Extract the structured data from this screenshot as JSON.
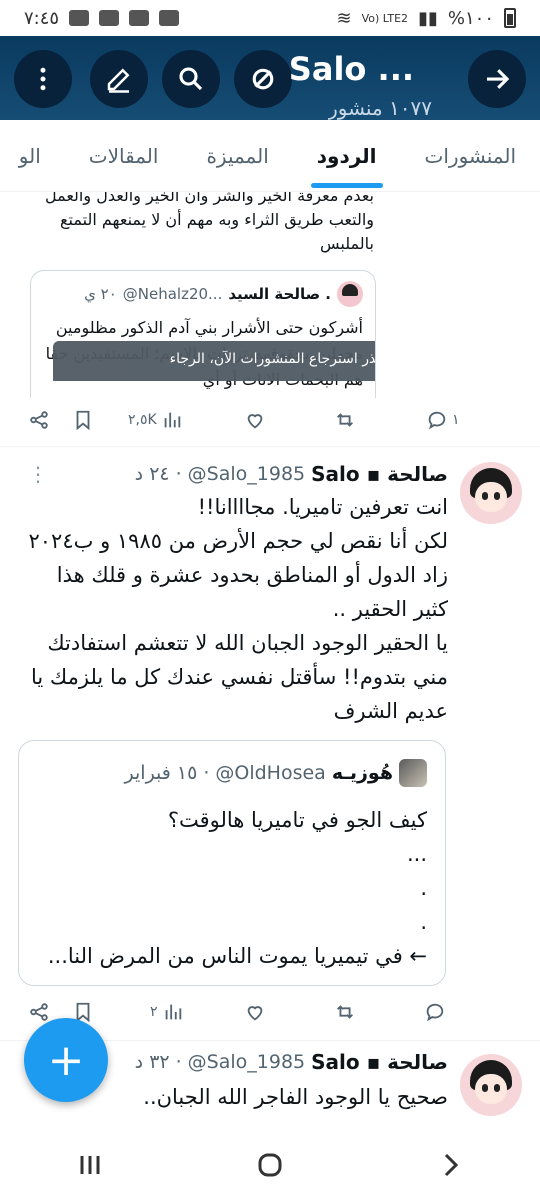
{
  "status_bar": {
    "time": "٧:٤٥",
    "battery": "%١٠٠",
    "network": "Vo) LTE2"
  },
  "header": {
    "title": "Salo ...",
    "subtitle": "١٠٧٧ منشور"
  },
  "tabs": [
    {
      "label": "المنشورات",
      "active": false
    },
    {
      "label": "الردود",
      "active": true
    },
    {
      "label": "المميزة",
      "active": false
    },
    {
      "label": "المقالات",
      "active": false
    },
    {
      "label": "الو",
      "active": false
    }
  ],
  "top_post": {
    "text": "بعدم معرفة الخير والشر وأن الخير والعدل والعمل والتعب طريق الثراء وبه مهم أن لا يمنعهم التمتع بالملبس",
    "quote": {
      "name": "صالحة السيد .",
      "handle": "@Nehalz20...",
      "time": "٢٠ ي",
      "text": "أشركون حتى الأشرار بني آدم الذكور مظلومين مجهلين بحقوقهم تروات بالاسم؛ المستفيدين حقا هم البحمات الاناث أو أي"
    },
    "toast": "تعذر استرجاع المنشورات الآن، الرجاء",
    "actions": {
      "replies": "١",
      "retweets": "",
      "likes": "",
      "views": "٢,٥K"
    }
  },
  "tweet": {
    "name": "صالحة ▪ Salo",
    "handle": "@Salo_1985",
    "time": "٢٤ د",
    "lines": [
      "انت تعرفين تاميريا. مجاااانا!!",
      "لكن أنا نقص لي حجم الأرض من ١٩٨٥ و ب٢٠٢٤",
      "زاد الدول أو المناطق بحدود عشرة و قلك هذا",
      "كثير الحقير ..",
      "يا الحقير الوجود الجبان الله لا تتعشم استفادتك",
      "مني بتدوم!! سأقتل نفسي عندك كل ما يلزمك يا",
      "عديم الشرف"
    ],
    "quote": {
      "name": "هُوزيـه",
      "handle": "@OldHosea",
      "time": "١٥ فبراير",
      "lines": [
        "كيف الجو في تاميريا هالوقت؟",
        "...",
        ".",
        ".",
        "← في تيميريا يموت الناس من المرض النا..."
      ]
    },
    "actions": {
      "replies": "",
      "retweets": "",
      "likes": "",
      "views": "٢"
    }
  },
  "next_tweet": {
    "name": "صالحة ▪ Salo",
    "handle": "@Salo_1985",
    "time": "٣٢ د",
    "text": "صحيح يا الوجود الفاجر الله الجبان.."
  },
  "fab_label": "+"
}
